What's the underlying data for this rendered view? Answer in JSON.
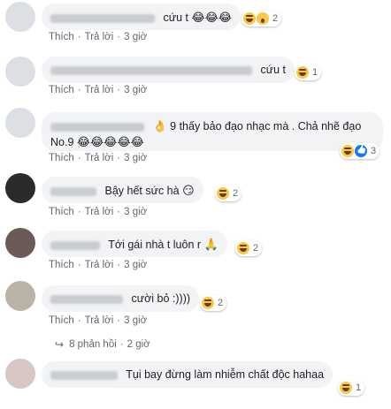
{
  "actions": {
    "like": "Thích",
    "reply": "Trả lời",
    "sep": "·"
  },
  "comments": [
    {
      "text": "cứu t",
      "emojis": "😂😂😂",
      "reaction_count": "2",
      "time": "3 giờ"
    },
    {
      "text": "cứu t",
      "emojis": "",
      "reaction_count": "1",
      "time": "3 giờ"
    },
    {
      "text": "9 thấy bảo đạo nhạc mà . Chả nhẽ đạo",
      "text2": "No.9",
      "lead_emoji": "👌",
      "emojis": "😂😂😂😂😂",
      "reaction_count": "3",
      "time": "3 giờ"
    },
    {
      "text": "Bậy hết sức hà",
      "emojis": "😏",
      "reaction_count": "2",
      "time": "3 giờ"
    },
    {
      "text": "Tới gái nhà t luôn r",
      "emojis": "🙏",
      "reaction_count": "2",
      "time": "3 giờ"
    },
    {
      "text": "cười bỏ :))))",
      "emojis": "",
      "reaction_count": "2",
      "time": "3 giờ"
    },
    {
      "text": "Tụi bay đừng làm nhiễm chất độc hahaa",
      "emojis": "",
      "reaction_count": "1",
      "time": ""
    }
  ],
  "replies_summary": {
    "label": "8 phản hồi",
    "time": "2 giờ"
  }
}
